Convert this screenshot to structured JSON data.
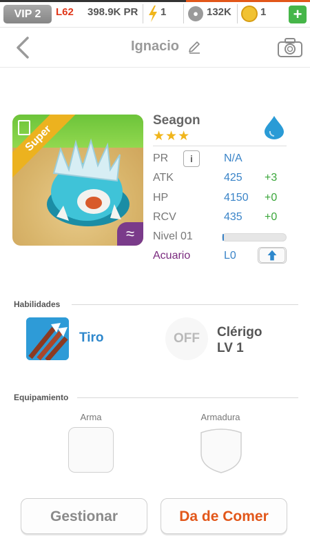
{
  "topbar": {
    "vip": "VIP 2",
    "level": "L62",
    "power": "398.9K PR",
    "energy": "1",
    "food": "132K",
    "coins": "1",
    "plus": "+"
  },
  "header": {
    "title": "Ignacio"
  },
  "monster": {
    "name": "Seagon",
    "stars": "★★★",
    "rarity_badge": "Super",
    "element_badge": "≈",
    "stats": {
      "pr_label": "PR",
      "pr_value": "N/A",
      "atk_label": "ATK",
      "atk_value": "425",
      "atk_bonus": "+3",
      "hp_label": "HP",
      "hp_value": "4150",
      "hp_bonus": "+0",
      "rcv_label": "RCV",
      "rcv_value": "435",
      "rcv_bonus": "+0",
      "level_label": "Nivel 01",
      "level_progress": 0.02,
      "habitat_label": "Acuario",
      "habitat_value": "L0"
    }
  },
  "skills": {
    "section_title": "Habilidades",
    "skill1_name": "Tiro",
    "skill2_status": "OFF",
    "skill2_name": "Clérigo",
    "skill2_level": "LV 1"
  },
  "equipment": {
    "section_title": "Equipamiento",
    "weapon_label": "Arma",
    "armor_label": "Armadura"
  },
  "actions": {
    "manage_label": "Gestionar",
    "feed_label": "Da de Comer"
  },
  "colors": {
    "accent": "#e2571a",
    "stat_value": "#3a84c8",
    "bonus": "#3aa63a",
    "habitat": "#7a2a7e"
  }
}
